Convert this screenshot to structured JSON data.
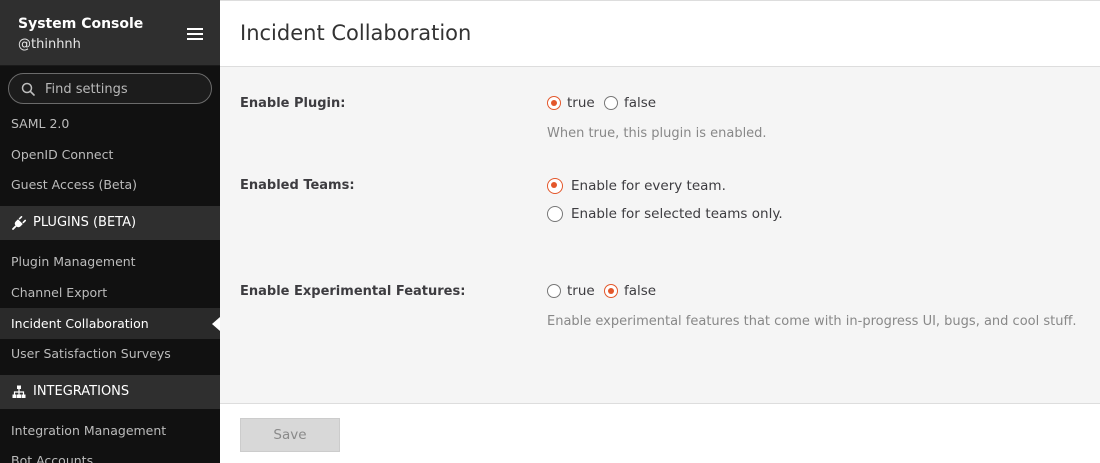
{
  "sidebar": {
    "title": "System Console",
    "username": "@thinhnh",
    "search": {
      "placeholder": "Find settings",
      "value": ""
    },
    "items_before": [
      {
        "label": "SAML 2.0"
      },
      {
        "label": "OpenID Connect"
      },
      {
        "label": "Guest Access (Beta)"
      }
    ],
    "plugins_section": {
      "label": "PLUGINS (BETA)",
      "icon": "plug-icon"
    },
    "plugin_items": [
      {
        "label": "Plugin Management"
      },
      {
        "label": "Channel Export"
      },
      {
        "label": "Incident Collaboration",
        "active": true
      },
      {
        "label": "User Satisfaction Surveys"
      }
    ],
    "integrations_section": {
      "label": "INTEGRATIONS",
      "icon": "sitemap-icon"
    },
    "integration_items": [
      {
        "label": "Integration Management"
      },
      {
        "label": "Bot Accounts"
      }
    ]
  },
  "page": {
    "title": "Incident Collaboration",
    "settings": {
      "enable_plugin": {
        "label": "Enable Plugin:",
        "options": [
          {
            "label": "true",
            "checked": true
          },
          {
            "label": "false",
            "checked": false
          }
        ],
        "help": "When true, this plugin is enabled."
      },
      "enabled_teams": {
        "label": "Enabled Teams:",
        "options": [
          {
            "label": "Enable for every team.",
            "checked": true
          },
          {
            "label": "Enable for selected teams only.",
            "checked": false
          }
        ]
      },
      "experimental": {
        "label": "Enable Experimental Features:",
        "options": [
          {
            "label": "true",
            "checked": false
          },
          {
            "label": "false",
            "checked": true
          }
        ],
        "help": "Enable experimental features that come with in-progress UI, bugs, and cool stuff."
      }
    },
    "save_label": "Save"
  },
  "colors": {
    "accent": "#e3572b",
    "sidebar_bg": "#111111",
    "sidebar_header_bg": "#2f2f2f",
    "content_bg": "#f5f5f5"
  }
}
